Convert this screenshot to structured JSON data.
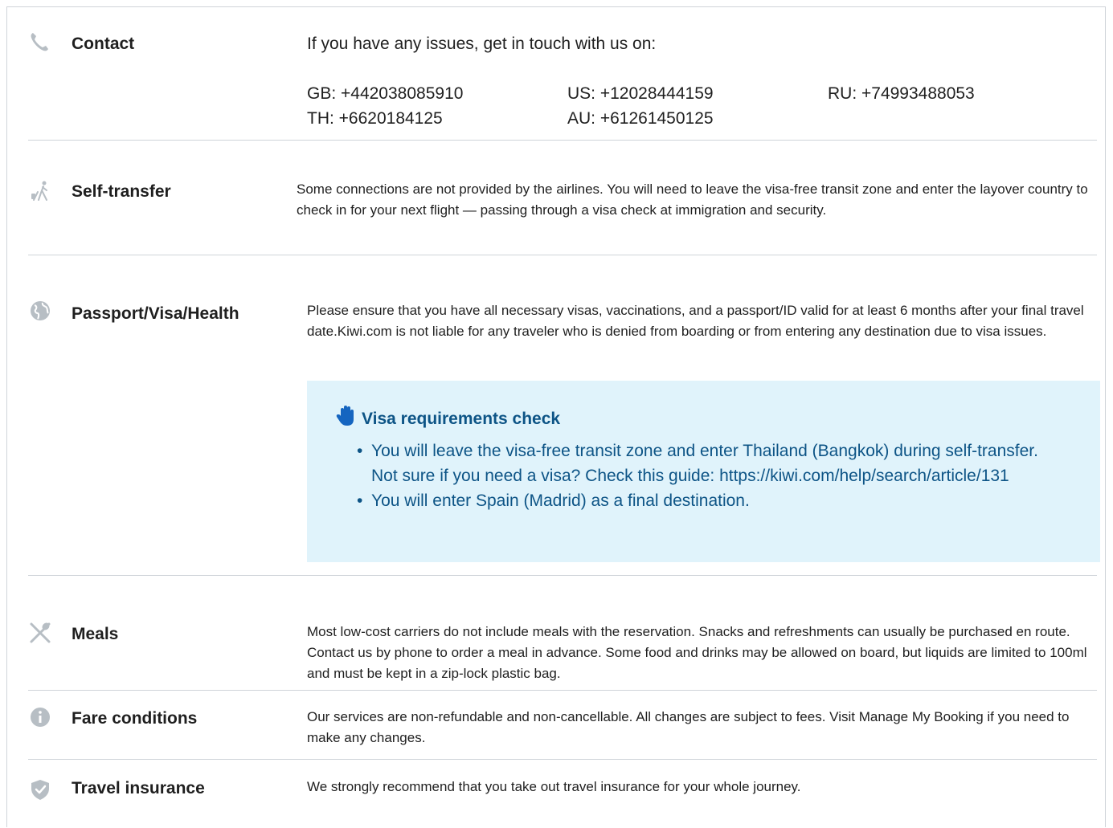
{
  "contact": {
    "title": "Contact",
    "intro": "If you have any issues, get in touch with us on:",
    "phones": [
      "GB: +442038085910",
      "US: +12028444159",
      "RU: +74993488053",
      "TH: +6620184125",
      "AU: +61261450125"
    ]
  },
  "self_transfer": {
    "title": "Self-transfer",
    "text": "Some connections are not provided by the airlines. You will need to leave the visa-free transit zone and enter the layover country to check in for your next flight — passing through a visa check at immigration and security."
  },
  "passport": {
    "title": "Passport/Visa/Health",
    "text": "Please ensure that you have all necessary visas, vaccinations, and a passport/ID valid for at least 6 months after your final travel date.Kiwi.com is not liable for any traveler who is denied from boarding or from entering any destination due to visa issues.",
    "visa_check": {
      "title": "Visa requirements check",
      "items": [
        "You will leave the visa-free transit zone and enter Thailand (Bangkok) during self-transfer. Not sure if you need a visa? Check this guide: https://kiwi.com/help/search/article/131",
        "You will enter Spain (Madrid) as a final destination."
      ]
    }
  },
  "meals": {
    "title": "Meals",
    "text": "Most low-cost carriers do not include meals with the reservation. Snacks and refreshments can usually be purchased en route. Contact us by phone to order a meal in advance. Some food and drinks may be allowed on board, but liquids are limited to 100ml and must be kept in a zip-lock plastic bag."
  },
  "fare_conditions": {
    "title": "Fare conditions",
    "text": "Our services are non-refundable and non-cancellable. All changes are subject to fees. Visit Manage My Booking if you need to make any changes."
  },
  "travel_insurance": {
    "title": "Travel insurance",
    "text": "We strongly recommend that you take out travel insurance for your whole journey."
  },
  "icons": {
    "contact": "phone-icon",
    "self_transfer": "traveler-icon",
    "passport": "globe-icon",
    "visa_check": "hand-icon",
    "meals": "cutlery-icon",
    "fare_conditions": "info-icon",
    "travel_insurance": "shield-icon"
  },
  "colors": {
    "icon_gray": "#b7bec4",
    "visa_box_bg": "#e0f3fb",
    "visa_text": "#0d5486",
    "visa_hand": "#1565c0",
    "divider": "#cfd4d9"
  }
}
